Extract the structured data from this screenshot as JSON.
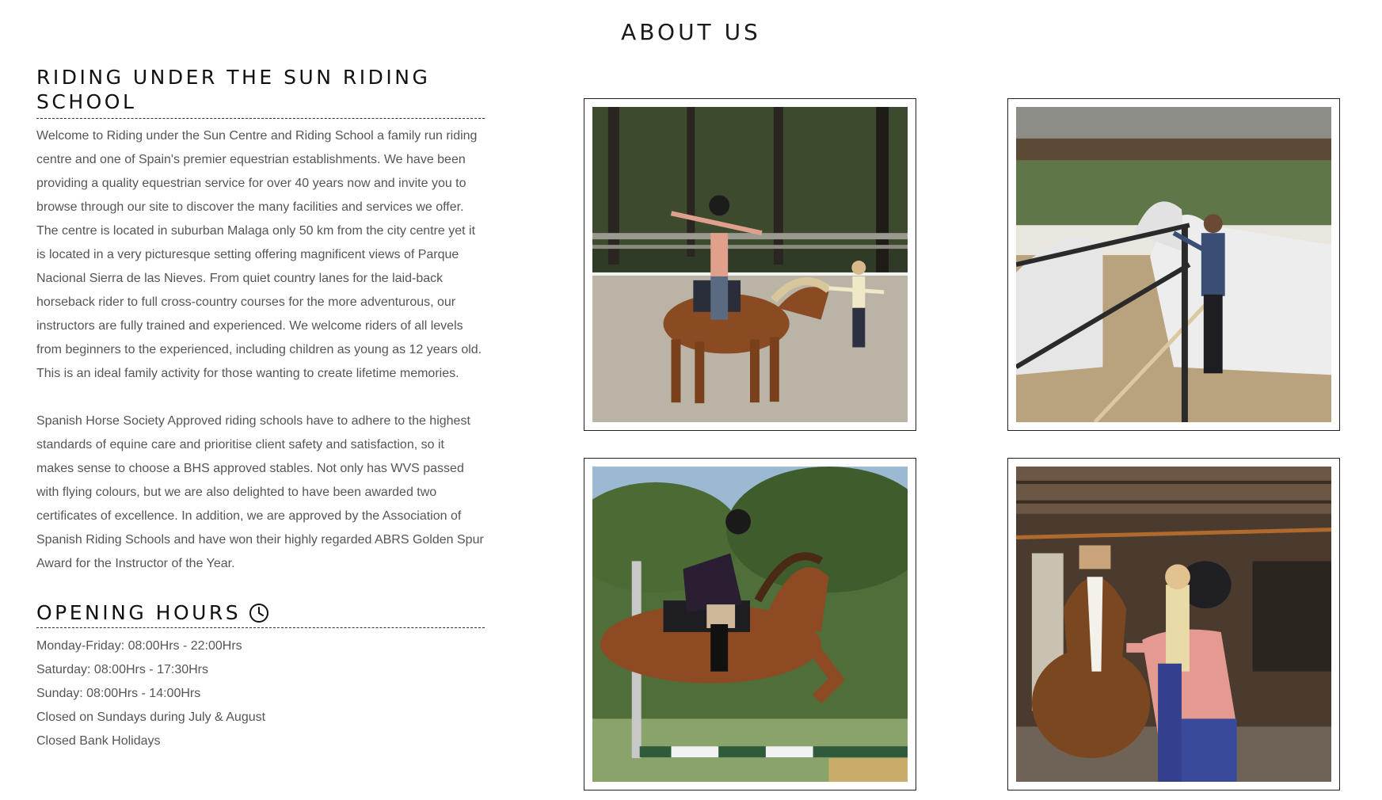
{
  "page_title": "ABOUT US",
  "school": {
    "heading": "RIDING UNDER THE SUN RIDING SCHOOL",
    "paragraph_1": "Welcome to Riding under the Sun Centre and Riding School a family run riding centre and one of Spain's premier equestrian establishments. We have been providing a quality equestrian service for over 40 years now and invite you to browse through our site to discover the many facilities and services we offer. The centre is located in suburban Malaga only 50 km from the city centre yet it is located in a very picturesque setting offering magnificent views of Parque Nacional Sierra de las Nieves. From quiet country lanes for the laid-back horseback rider to full cross-country courses for the more adventurous, our instructors are fully trained and experienced. We welcome riders of all levels from beginners to the experienced, including children as young as 12 years old. This is an ideal family activity for those wanting to create lifetime memories.",
    "paragraph_2": "Spanish Horse Society Approved riding schools have to adhere to the highest standards of equine care and prioritise client safety and satisfaction, so it makes sense to choose a BHS approved stables. Not only has WVS passed with flying colours, but we are also delighted to have been awarded two certificates of excellence. In addition, we are approved by the Association of Spanish Riding Schools and have won their highly regarded ABRS Golden Spur Award for the Instructor of the Year."
  },
  "opening_hours": {
    "heading": "OPENING HOURS",
    "icon": "clock-icon",
    "lines": [
      "Monday-Friday: 08:00Hrs - 22:00Hrs",
      "Saturday: 08:00Hrs - 17:30Hrs",
      "Sunday: 08:00Hrs - 14:00Hrs",
      "Closed on Sundays during July & August",
      "Closed Bank Holidays"
    ]
  },
  "colors": {
    "heading_text": "#111111",
    "body_text": "#555555",
    "frame_border": "#222222",
    "background": "#ffffff"
  }
}
